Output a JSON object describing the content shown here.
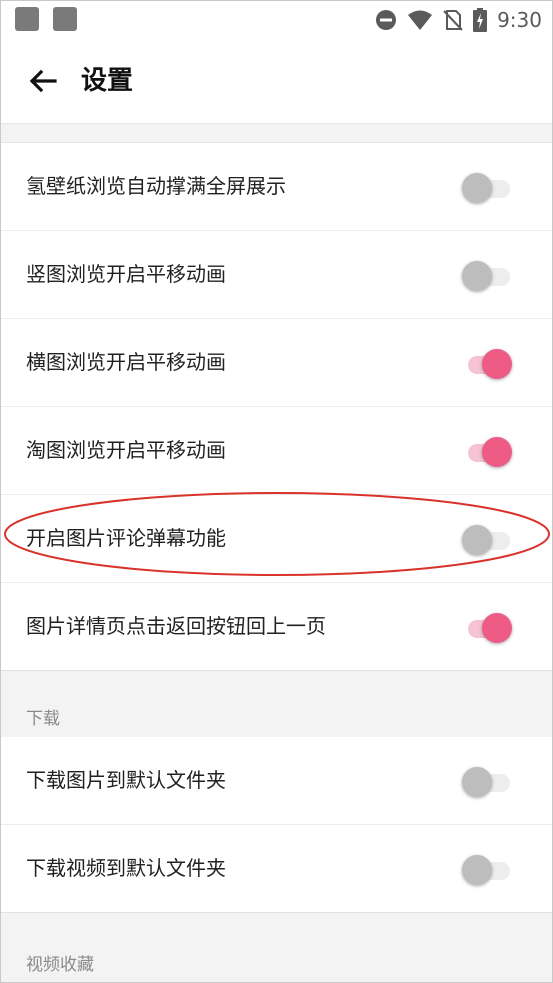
{
  "status_bar": {
    "time": "9:30"
  },
  "app_bar": {
    "title": "设置"
  },
  "rows_group1": [
    {
      "label": "氢壁纸浏览自动撑满全屏展示",
      "on": false
    },
    {
      "label": "竖图浏览开启平移动画",
      "on": false
    },
    {
      "label": "横图浏览开启平移动画",
      "on": true
    },
    {
      "label": "淘图浏览开启平移动画",
      "on": true
    },
    {
      "label": "开启图片评论弹幕功能",
      "on": false
    },
    {
      "label": "图片详情页点击返回按钮回上一页",
      "on": true
    }
  ],
  "section_download": {
    "label": "下载"
  },
  "rows_download": [
    {
      "label": "下载图片到默认文件夹",
      "on": false
    },
    {
      "label": "下载视频到默认文件夹",
      "on": false
    }
  ],
  "section_video": {
    "label": "视频收藏"
  },
  "colors": {
    "accent": "#ee5c86",
    "accent_track": "#f6c3d3",
    "annotation": "#d9322a"
  }
}
